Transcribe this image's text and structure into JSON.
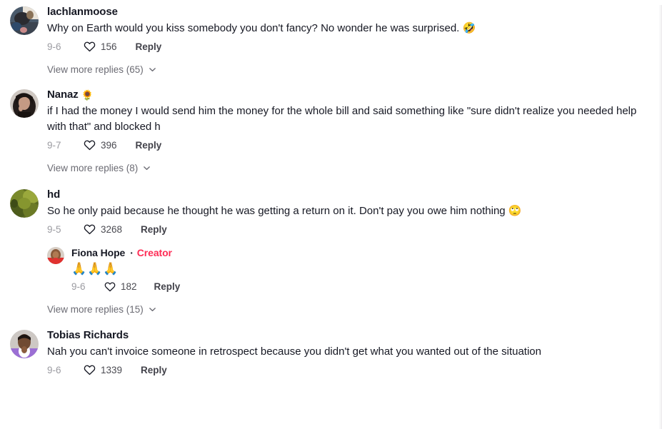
{
  "theme": {
    "background": "#ffffff",
    "text_primary": "#161823",
    "text_muted": "#9b9ba1",
    "creator_accent": "#fe2c55"
  },
  "icons": {
    "heart": "heart-outline-icon",
    "chevron": "chevron-down-icon"
  },
  "comments": [
    {
      "username": "lachlanmoose",
      "badge": "",
      "text": "Why on Earth would you kiss somebody you don't fancy? No wonder he was surprised. 🤣",
      "date": "9-6",
      "likes": "156",
      "reply_label": "Reply",
      "view_more": "View more replies (65)",
      "replies": []
    },
    {
      "username": "Nanaz",
      "name_emoji": "🌻",
      "badge": "",
      "text": "if I had the money I would send him the money for the whole bill and said something like \"sure didn't realize you needed help with that\" and blocked h",
      "date": "9-7",
      "likes": "396",
      "reply_label": "Reply",
      "view_more": "View more replies (8)",
      "replies": []
    },
    {
      "username": "hd",
      "badge": "",
      "text": "So he only paid because he thought he was getting a return on it. Don't pay you owe him nothing 🙄",
      "date": "9-5",
      "likes": "3268",
      "reply_label": "Reply",
      "view_more": "View more replies (15)",
      "replies": [
        {
          "username": "Fiona Hope",
          "separator": "·",
          "badge": "Creator",
          "text": "🙏🙏🙏",
          "date": "9-6",
          "likes": "182",
          "reply_label": "Reply"
        }
      ]
    },
    {
      "username": "Tobias Richards",
      "badge": "",
      "text": "Nah you can't invoice someone in retrospect because you didn't get what you wanted out of the situation",
      "date": "9-6",
      "likes": "1339",
      "reply_label": "Reply",
      "view_more": "",
      "replies": []
    }
  ]
}
